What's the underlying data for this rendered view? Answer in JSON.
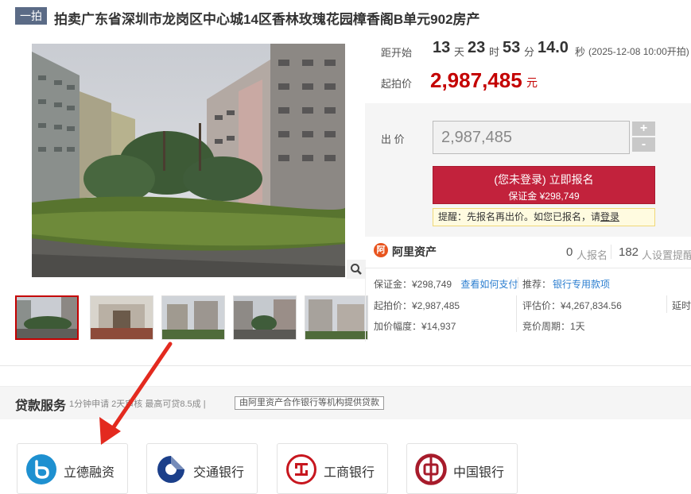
{
  "header": {
    "tag": "一拍",
    "title": "拍卖广东省深圳市龙岗区中心城14区香林玫瑰花园樟香阁B单元902房产"
  },
  "countdown": {
    "label": "距开始",
    "days": "13",
    "days_unit": "天",
    "hours": "23",
    "hours_unit": "时",
    "minutes": "53",
    "minutes_unit": "分",
    "seconds": "14.0",
    "seconds_unit": "秒",
    "start_time": "(2025-12-08 10:00开拍)"
  },
  "start_price": {
    "label": "起拍价",
    "value": "2,987,485",
    "unit": "元"
  },
  "bid": {
    "label": "出 价",
    "input_value": "2,987,485",
    "plus": "+",
    "minus": "-",
    "signup_line1": "(您未登录) 立即报名",
    "signup_line2": "保证金 ¥298,749",
    "notice_prefix": "提醒：先报名再出价。如您已报名，请",
    "notice_link": "登录"
  },
  "org": {
    "logo_text": "阿",
    "name": "阿里资产",
    "signups_num": "0",
    "signups_label": "人报名",
    "reminders_num": "182",
    "reminders_label": "人设置提醒"
  },
  "details": {
    "deposit": "保证金：¥298,749",
    "deposit_link": "查看如何支付",
    "recommend_label": "推荐：",
    "recommend_link": "银行专用款项",
    "start_price": "起拍价：¥2,987,485",
    "appraisal": "评估价：¥4,267,834.56",
    "delay": "延时",
    "increment": "加价幅度：¥14,937",
    "period": "竞价周期：1天"
  },
  "loan": {
    "title": "贷款服务",
    "subtitle": "1分钟申请 2天审核 最高可贷8.5成 |",
    "badge": "由阿里资产合作银行等机构提供贷款"
  },
  "banks": [
    {
      "name": "立德融资",
      "icon": "lide-logo-icon"
    },
    {
      "name": "交通银行",
      "icon": "bocom-logo-icon"
    },
    {
      "name": "工商银行",
      "icon": "icbc-logo-icon"
    },
    {
      "name": "中国银行",
      "icon": "boc-logo-icon"
    }
  ],
  "colors": {
    "accent_red": "#c40000",
    "button_red": "#c2223c",
    "link_blue": "#2d7fd0",
    "tag_bg": "#5b6b86"
  }
}
